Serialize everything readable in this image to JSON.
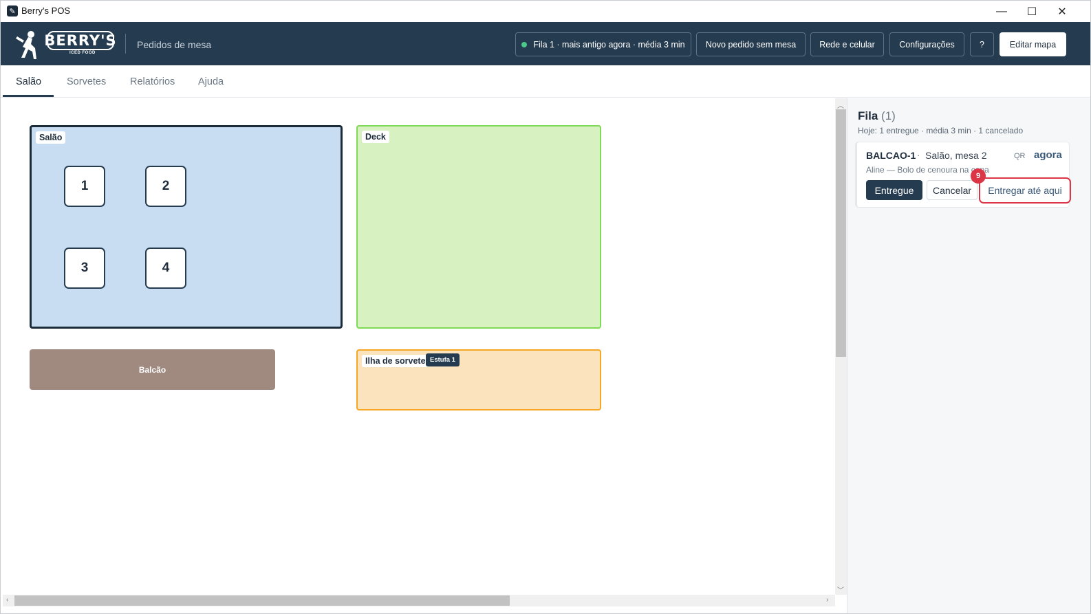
{
  "window": {
    "title": "Berry's POS",
    "controls": {
      "minimize": "—",
      "maximize": "☐",
      "close": "✕"
    }
  },
  "header": {
    "logo_text": "BERRY'S",
    "logo_subtext": "ICED FOOD",
    "subtitle": "Pedidos de mesa",
    "status": "Fila 1 · mais antigo agora · média 3 min",
    "buttons": {
      "new_order": "Novo pedido sem mesa",
      "network": "Rede e celular",
      "settings": "Configurações",
      "help": "?",
      "edit_map": "Editar mapa"
    },
    "colors": {
      "background": "#253b4f",
      "status_dot": "#4cc98a"
    }
  },
  "tabs": [
    {
      "label": "Salão",
      "active": true
    },
    {
      "label": "Sorvetes",
      "active": false
    },
    {
      "label": "Relatórios",
      "active": false
    },
    {
      "label": "Ajuda",
      "active": false
    }
  ],
  "map": {
    "zones": [
      {
        "name": "Salão",
        "color": "#c8dcf2",
        "border": "#1c2b3a"
      },
      {
        "name": "Deck",
        "color": "#d7f2c0",
        "border": "#7ed957"
      },
      {
        "name": "Balcão",
        "color": "#a08a80"
      },
      {
        "name": "Ilha de sorvete",
        "color": "#fbe3be",
        "border": "#f5a623",
        "badge": "Estufa 1"
      }
    ],
    "tables": [
      "1",
      "2",
      "3",
      "4"
    ]
  },
  "queue": {
    "title": "Fila",
    "count": "(1)",
    "summary": "Hoje: 1 entregue · média 3 min · 1 cancelado",
    "orders": [
      {
        "id": "BALCAO-1",
        "separator": "·",
        "location": "Salão, mesa 2",
        "source": "QR",
        "time": "agora",
        "detail": "Aline  —  Bolo de cenoura na capa",
        "actions": {
          "delivered": "Entregue",
          "cancel": "Cancelar",
          "deliver_until": "Entregar até aqui"
        }
      }
    ],
    "marker": "9"
  }
}
